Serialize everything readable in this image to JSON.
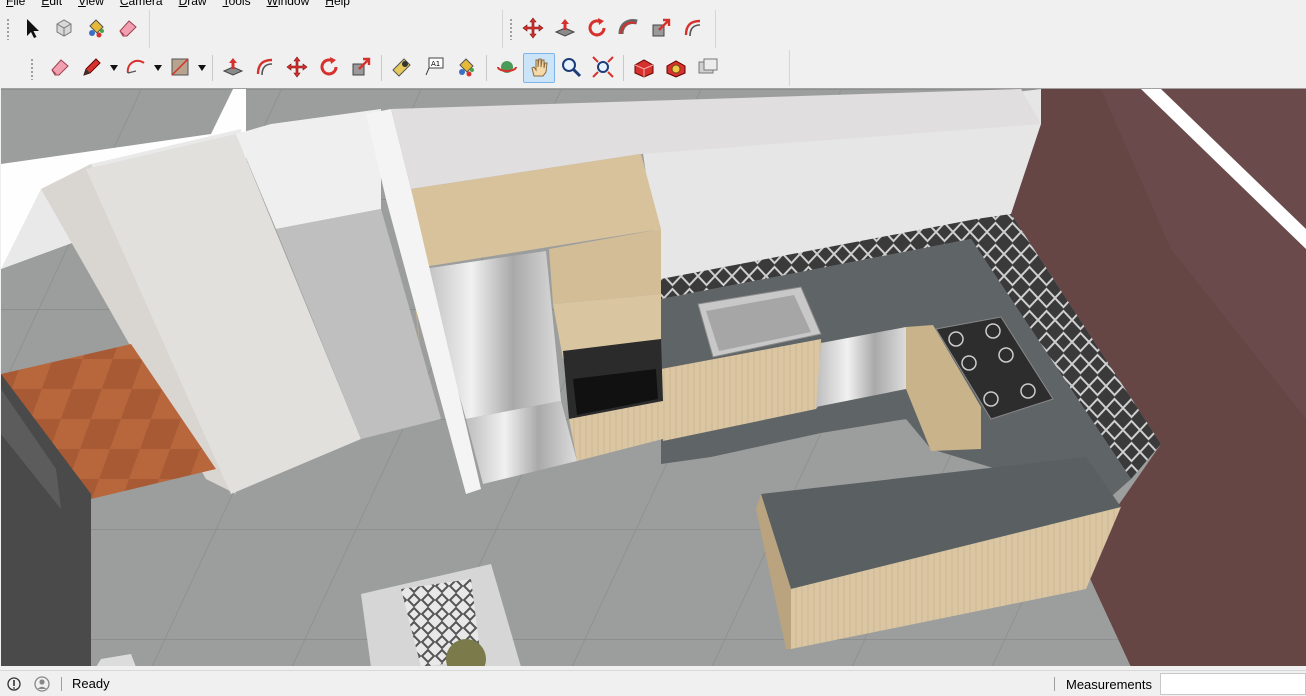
{
  "menu": [
    {
      "first": "F",
      "rest": "ile"
    },
    {
      "first": "E",
      "rest": "dit"
    },
    {
      "first": "V",
      "rest": "iew"
    },
    {
      "first": "C",
      "rest": "amera"
    },
    {
      "first": "D",
      "rest": "raw"
    },
    {
      "first": "T",
      "rest": "ools"
    },
    {
      "first": "W",
      "rest": "indow"
    },
    {
      "first": "H",
      "rest": "elp"
    }
  ],
  "toolbar_getting_started": [
    {
      "name": "select-tool",
      "icon": "arrow-cursor-icon"
    },
    {
      "name": "make-component-tool",
      "icon": "component-cube-icon"
    },
    {
      "name": "paint-bucket-tool",
      "icon": "paint-bucket-icon"
    },
    {
      "name": "eraser-tool",
      "icon": "eraser-icon"
    }
  ],
  "toolbar_edit": [
    {
      "name": "move-tool",
      "icon": "move-arrows-icon"
    },
    {
      "name": "push-pull-tool",
      "icon": "push-pull-icon"
    },
    {
      "name": "rotate-tool",
      "icon": "rotate-icon"
    },
    {
      "name": "follow-me-tool",
      "icon": "follow-me-icon"
    },
    {
      "name": "scale-tool",
      "icon": "scale-icon"
    },
    {
      "name": "offset-tool",
      "icon": "offset-icon"
    }
  ],
  "toolbar_main": [
    {
      "name": "eraser-tool",
      "icon": "eraser-icon"
    },
    {
      "name": "line-tool",
      "icon": "pencil-icon",
      "dropdown": true
    },
    {
      "name": "arc-tool",
      "icon": "arc-icon",
      "dropdown": true
    },
    {
      "name": "rectangle-tool",
      "icon": "rectangle-icon",
      "dropdown": true
    },
    {
      "sep": true
    },
    {
      "name": "push-pull-tool",
      "icon": "push-pull-icon"
    },
    {
      "name": "offset-tool",
      "icon": "offset-icon"
    },
    {
      "name": "move-tool",
      "icon": "move-arrows-icon"
    },
    {
      "name": "rotate-tool",
      "icon": "rotate-icon"
    },
    {
      "name": "scale-tool",
      "icon": "scale-icon"
    },
    {
      "sep": true
    },
    {
      "name": "tape-measure-tool",
      "icon": "tape-measure-icon"
    },
    {
      "name": "text-tool",
      "icon": "text-label-icon"
    },
    {
      "name": "paint-bucket-tool",
      "icon": "paint-bucket-icon"
    },
    {
      "sep": true
    },
    {
      "name": "orbit-tool",
      "icon": "orbit-icon"
    },
    {
      "name": "pan-tool",
      "icon": "hand-icon",
      "active": true
    },
    {
      "name": "zoom-tool",
      "icon": "magnifier-icon"
    },
    {
      "name": "zoom-extents-tool",
      "icon": "zoom-extents-icon"
    },
    {
      "sep": true
    },
    {
      "name": "3d-warehouse-button",
      "icon": "warehouse-icon"
    },
    {
      "name": "extension-warehouse-button",
      "icon": "extension-icon"
    },
    {
      "name": "layout-button",
      "icon": "layout-icon"
    }
  ],
  "status": {
    "text": "Ready",
    "measurements_label": "Measurements",
    "measurements_value": ""
  },
  "colors": {
    "accent_red": "#d6312c",
    "ui_bg": "#f0f0f0",
    "active_bg": "#cce4f7",
    "countertop": "#5d6265",
    "floor": "#9a9c9b",
    "wood": "#d9c4a0",
    "wall_brown": "#6a4a4a"
  }
}
